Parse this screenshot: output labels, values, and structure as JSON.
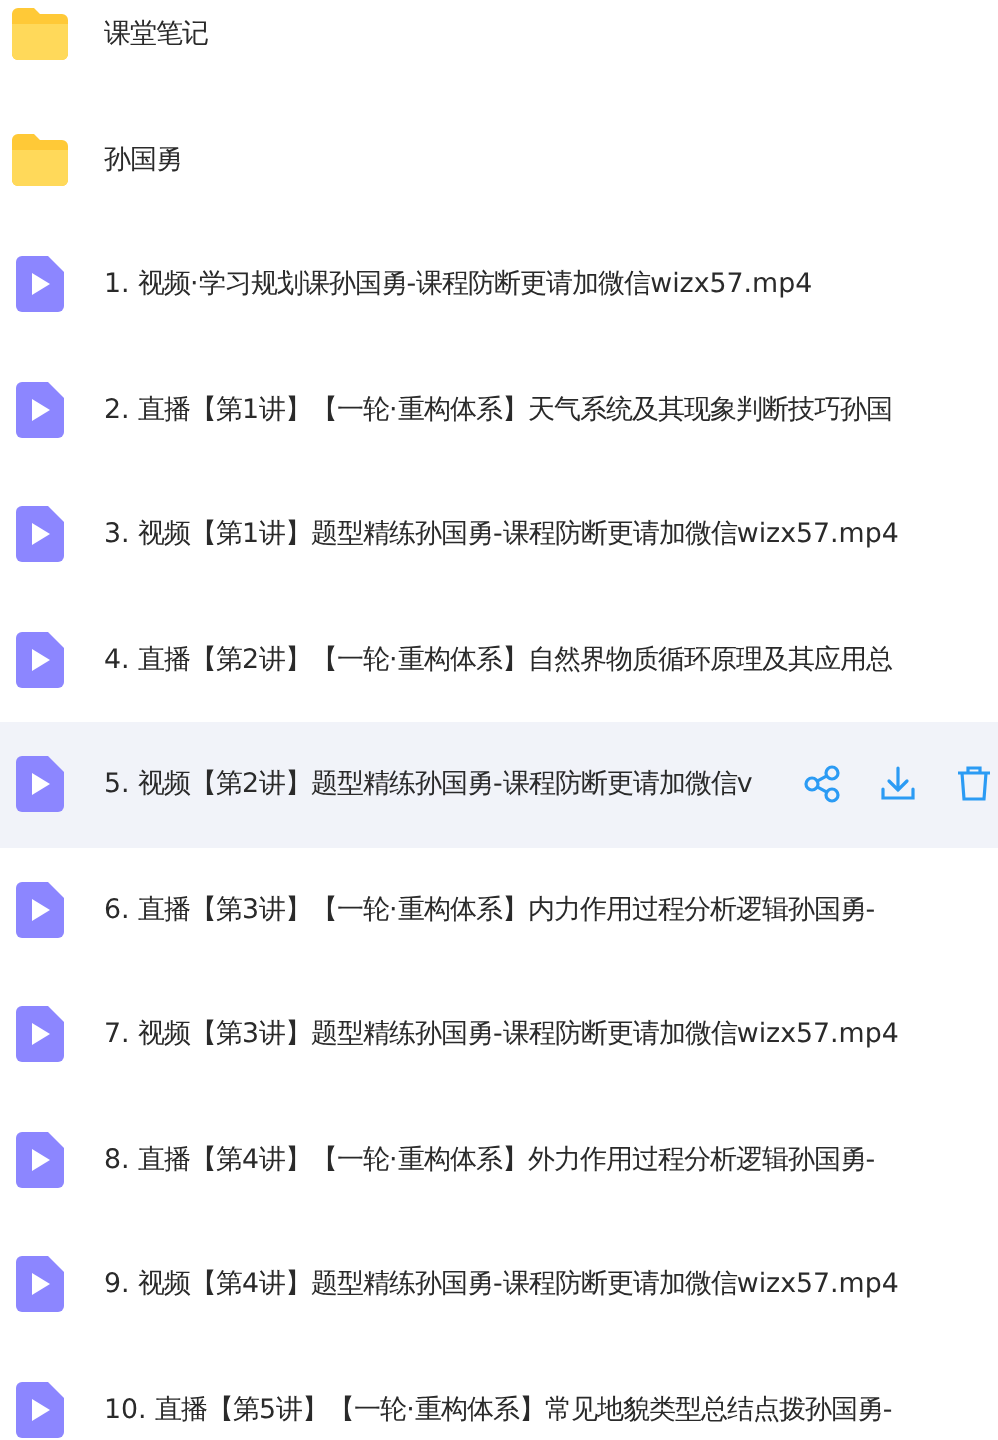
{
  "files": [
    {
      "kind": "folder",
      "name": "课堂笔记",
      "selected": false
    },
    {
      "kind": "folder",
      "name": "孙国勇",
      "selected": false
    },
    {
      "kind": "video",
      "name": "1. 视频·学习规划课孙国勇-课程防断更请加微信wizx57.mp4",
      "selected": false
    },
    {
      "kind": "video",
      "name": "2. 直播【第1讲】【一轮·重构体系】天气系统及其现象判断技巧孙国",
      "selected": false
    },
    {
      "kind": "video",
      "name": "3. 视频【第1讲】题型精练孙国勇-课程防断更请加微信wizx57.mp4",
      "selected": false
    },
    {
      "kind": "video",
      "name": "4. 直播【第2讲】【一轮·重构体系】自然界物质循环原理及其应用总",
      "selected": false
    },
    {
      "kind": "video",
      "name": "5. 视频【第2讲】题型精练孙国勇-课程防断更请加微信v",
      "selected": true
    },
    {
      "kind": "video",
      "name": "6. 直播【第3讲】【一轮·重构体系】内力作用过程分析逻辑孙国勇-",
      "selected": false
    },
    {
      "kind": "video",
      "name": "7. 视频【第3讲】题型精练孙国勇-课程防断更请加微信wizx57.mp4",
      "selected": false
    },
    {
      "kind": "video",
      "name": "8. 直播【第4讲】【一轮·重构体系】外力作用过程分析逻辑孙国勇-",
      "selected": false
    },
    {
      "kind": "video",
      "name": "9. 视频【第4讲】题型精练孙国勇-课程防断更请加微信wizx57.mp4",
      "selected": false
    },
    {
      "kind": "video",
      "name": "10. 直播【第5讲】【一轮·重构体系】常见地貌类型总结点拨孙国勇-",
      "selected": false
    }
  ]
}
